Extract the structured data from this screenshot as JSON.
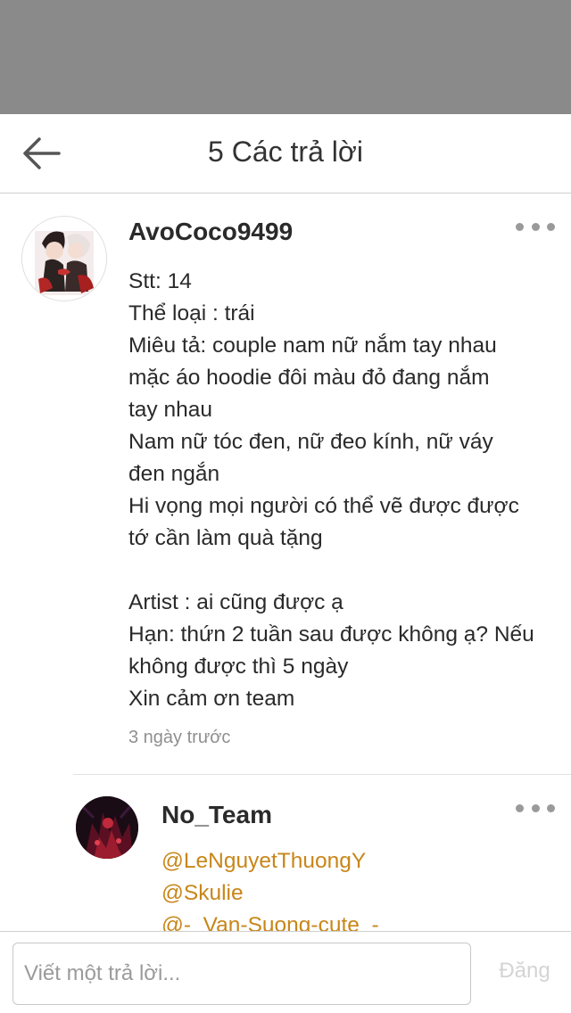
{
  "header": {
    "title": "5 Các trả lời",
    "back_icon": "arrow-left-icon"
  },
  "comment": {
    "username": "AvoCoco9499",
    "avatar": "couple-anime-avatar",
    "lines": [
      "Stt: 14",
      "Thể loại : trái",
      "Miêu tả: couple nam nữ nắm tay nhau",
      "mặc áo hoodie đôi màu đỏ đang nắm",
      "tay nhau",
      "Nam nữ tóc đen, nữ đeo kính, nữ váy",
      "đen ngắn",
      "Hi vọng mọi người có thể vẽ được  được",
      "tớ cần làm quà tặng",
      "",
      "Artist : ai cũng được ạ",
      "Hạn: thứn 2 tuần sau được không ạ? Nếu",
      "không được thì 5 ngày",
      "Xin cảm ơn team"
    ],
    "timestamp": "3 ngày trước"
  },
  "reply": {
    "username": "No_Team",
    "avatar": "dark-red-art-avatar",
    "mentions": [
      "@LeNguyetThuongY",
      "@Skulie",
      "@-_Van-Suong-cute_-"
    ]
  },
  "composer": {
    "placeholder": "Viết một trả lời...",
    "submit_label": "Đăng"
  },
  "colors": {
    "status_bar": "#8a8a8a",
    "mention": "#c8861a",
    "muted": "#8f8f8f",
    "disabled": "#d4d4d4"
  }
}
